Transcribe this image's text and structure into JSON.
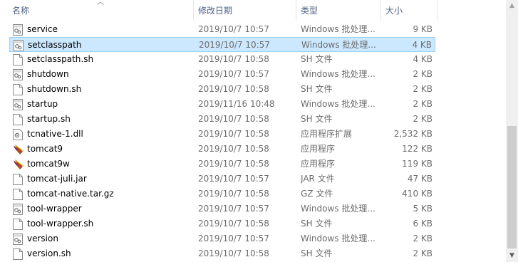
{
  "columns": {
    "name": "名称",
    "modified": "修改日期",
    "type": "类型",
    "size": "大小"
  },
  "files": [
    {
      "name": "service",
      "date": "2019/10/7 10:57",
      "type": "Windows 批处理...",
      "size": "9 KB",
      "icon": "batch-file-icon",
      "selected": false
    },
    {
      "name": "setclasspath",
      "date": "2019/10/7 10:57",
      "type": "Windows 批处理...",
      "size": "4 KB",
      "icon": "batch-file-icon",
      "selected": true
    },
    {
      "name": "setclasspath.sh",
      "date": "2019/10/7 10:58",
      "type": "SH 文件",
      "size": "4 KB",
      "icon": "file-icon",
      "selected": false
    },
    {
      "name": "shutdown",
      "date": "2019/10/7 10:57",
      "type": "Windows 批处理...",
      "size": "2 KB",
      "icon": "batch-file-icon",
      "selected": false
    },
    {
      "name": "shutdown.sh",
      "date": "2019/10/7 10:58",
      "type": "SH 文件",
      "size": "2 KB",
      "icon": "file-icon",
      "selected": false
    },
    {
      "name": "startup",
      "date": "2019/11/16 10:48",
      "type": "Windows 批处理...",
      "size": "2 KB",
      "icon": "batch-file-icon",
      "selected": false
    },
    {
      "name": "startup.sh",
      "date": "2019/10/7 10:58",
      "type": "SH 文件",
      "size": "2 KB",
      "icon": "file-icon",
      "selected": false
    },
    {
      "name": "tcnative-1.dll",
      "date": "2019/10/7 10:58",
      "type": "应用程序扩展",
      "size": "2,532 KB",
      "icon": "dll-file-icon",
      "selected": false
    },
    {
      "name": "tomcat9",
      "date": "2019/10/7 10:58",
      "type": "应用程序",
      "size": "122 KB",
      "icon": "tomcat-app-icon",
      "selected": false
    },
    {
      "name": "tomcat9w",
      "date": "2019/10/7 10:58",
      "type": "应用程序",
      "size": "119 KB",
      "icon": "tomcat-app-icon",
      "selected": false
    },
    {
      "name": "tomcat-juli.jar",
      "date": "2019/10/7 10:57",
      "type": "JAR 文件",
      "size": "47 KB",
      "icon": "file-icon",
      "selected": false
    },
    {
      "name": "tomcat-native.tar.gz",
      "date": "2019/10/7 10:58",
      "type": "GZ 文件",
      "size": "410 KB",
      "icon": "file-icon",
      "selected": false
    },
    {
      "name": "tool-wrapper",
      "date": "2019/10/7 10:57",
      "type": "Windows 批处理...",
      "size": "5 KB",
      "icon": "batch-file-icon",
      "selected": false
    },
    {
      "name": "tool-wrapper.sh",
      "date": "2019/10/7 10:58",
      "type": "SH 文件",
      "size": "6 KB",
      "icon": "file-icon",
      "selected": false
    },
    {
      "name": "version",
      "date": "2019/10/7 10:57",
      "type": "Windows 批处理...",
      "size": "2 KB",
      "icon": "batch-file-icon",
      "selected": false
    },
    {
      "name": "version.sh",
      "date": "2019/10/7 10:58",
      "type": "SH 文件",
      "size": "2 KB",
      "icon": "file-icon",
      "selected": false
    }
  ],
  "colors": {
    "selection_bg": "#cce8ff",
    "selection_border": "#99d1ff",
    "header_text": "#4d6185",
    "secondary_text": "#6d6d6d"
  }
}
